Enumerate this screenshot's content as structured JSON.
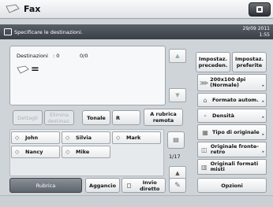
{
  "header": {
    "title": "Fax"
  },
  "status": {
    "message": "Specificare le destinazioni.",
    "date": "29/09 2011",
    "time": "1:55"
  },
  "destinations": {
    "label": "Destinazioni",
    "count": ": 0",
    "pages": "0/0",
    "equals": "="
  },
  "actions": {
    "details": "Dettagli",
    "delete": "Elimina destinaz.",
    "tone": "Tonale",
    "r": "R",
    "remote": "A rubrica remota"
  },
  "contacts": [
    {
      "name": "John"
    },
    {
      "name": "Silvia"
    },
    {
      "name": "Mark"
    },
    {
      "name": "Nancy"
    },
    {
      "name": "Mike"
    }
  ],
  "pagination": "1/17",
  "bottom_actions": {
    "addressbook": "Rubrica",
    "hook": "Aggancio",
    "direct_send": "Invio diretto"
  },
  "right_panel": {
    "prev_settings": "Impostaz. preceden.",
    "fav_settings": "Impostaz. preferite",
    "resolution": "200x100 dpi (Normale)",
    "format": "Formato autom.",
    "density": "Densità",
    "original_type": "Tipo di originale",
    "duplex": "Originale fronte-retro",
    "mixed": "Originali formati misti",
    "options": "Opzioni"
  }
}
